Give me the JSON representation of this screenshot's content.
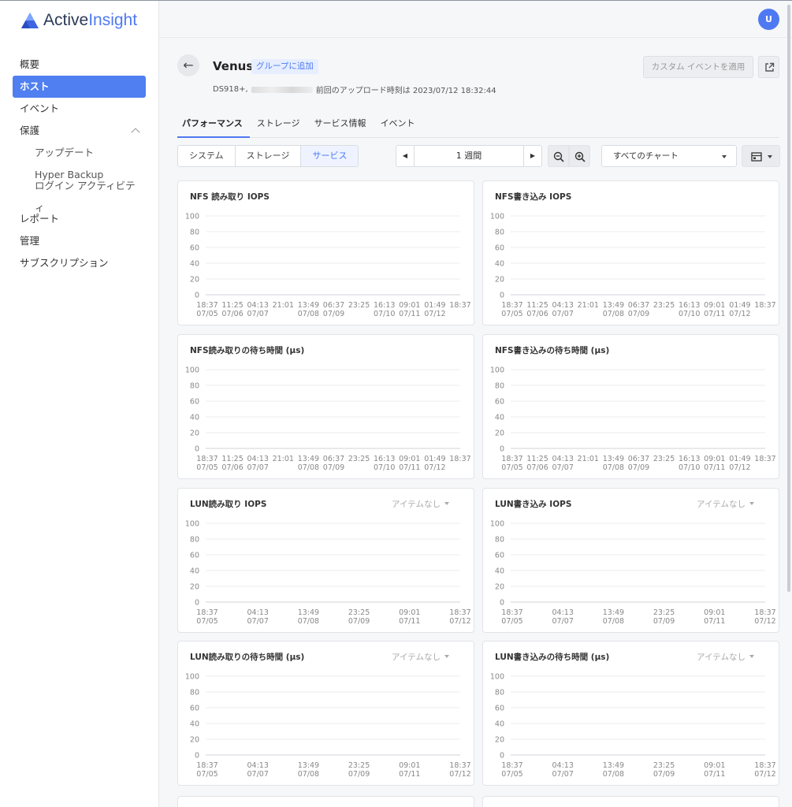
{
  "app": {
    "logo_prefix": "Active",
    "logo_accent": "Insight",
    "user_initial": "U"
  },
  "sidebar": {
    "items": [
      {
        "label": "概要",
        "active": false,
        "sub": false
      },
      {
        "label": "ホスト",
        "active": true,
        "sub": false
      },
      {
        "label": "イベント",
        "active": false,
        "sub": false
      },
      {
        "label": "保護",
        "active": false,
        "sub": false,
        "expanded": true
      },
      {
        "label": "アップデート",
        "active": false,
        "sub": true
      },
      {
        "label": "Hyper Backup",
        "active": false,
        "sub": true
      },
      {
        "label": "ログイン アクティビティ",
        "active": false,
        "sub": true
      },
      {
        "label": "レポート",
        "active": false,
        "sub": false
      },
      {
        "label": "管理",
        "active": false,
        "sub": false
      },
      {
        "label": "サブスクリプション",
        "active": false,
        "sub": false
      }
    ]
  },
  "header": {
    "host_name": "Venus",
    "group_badge": "グループに追加",
    "model": "DS918+,",
    "last_upload_text": "前回のアップロード時刻は 2023/07/12 18:32:44",
    "custom_event_button": "カスタム イベントを適用"
  },
  "tabs": [
    "パフォーマンス",
    "ストレージ",
    "サービス情報",
    "イベント"
  ],
  "toolbar": {
    "segments": [
      {
        "label": "システム",
        "active": false
      },
      {
        "label": "ストレージ",
        "active": false
      },
      {
        "label": "サービス",
        "active": true
      }
    ],
    "range_label": "1 週間",
    "chart_filter": "すべてのチャート"
  },
  "colors": {
    "accent": "#4f79f2",
    "active_nav": "#4f7ff0"
  },
  "chart_data": [
    {
      "type": "line",
      "title": "NFS 読み取り IOPS",
      "empty_selector": "",
      "yticks": [
        "100",
        "80",
        "60",
        "40",
        "20",
        "0"
      ],
      "ylim": [
        0,
        100
      ],
      "series": [],
      "xticks": [
        [
          "18:37",
          "07/05"
        ],
        [
          "11:25",
          "07/06"
        ],
        [
          "04:13",
          "07/07"
        ],
        [
          "21:01",
          ""
        ],
        [
          "13:49",
          "07/08"
        ],
        [
          "06:37",
          "07/09"
        ],
        [
          "23:25",
          ""
        ],
        [
          "16:13",
          "07/10"
        ],
        [
          "09:01",
          "07/11"
        ],
        [
          "01:49",
          "07/12"
        ],
        [
          "18:37",
          ""
        ]
      ]
    },
    {
      "type": "line",
      "title": "NFS書き込み IOPS",
      "empty_selector": "",
      "yticks": [
        "100",
        "80",
        "60",
        "40",
        "20",
        "0"
      ],
      "ylim": [
        0,
        100
      ],
      "series": [],
      "xticks": [
        [
          "18:37",
          "07/05"
        ],
        [
          "11:25",
          "07/06"
        ],
        [
          "04:13",
          "07/07"
        ],
        [
          "21:01",
          ""
        ],
        [
          "13:49",
          "07/08"
        ],
        [
          "06:37",
          "07/09"
        ],
        [
          "23:25",
          ""
        ],
        [
          "16:13",
          "07/10"
        ],
        [
          "09:01",
          "07/11"
        ],
        [
          "01:49",
          "07/12"
        ],
        [
          "18:37",
          ""
        ]
      ]
    },
    {
      "type": "line",
      "title": "NFS読み取りの待ち時間 (µs)",
      "empty_selector": "",
      "yticks": [
        "100",
        "80",
        "60",
        "40",
        "20",
        "0"
      ],
      "ylim": [
        0,
        100
      ],
      "series": [],
      "xticks": [
        [
          "18:37",
          "07/05"
        ],
        [
          "11:25",
          "07/06"
        ],
        [
          "04:13",
          "07/07"
        ],
        [
          "21:01",
          ""
        ],
        [
          "13:49",
          "07/08"
        ],
        [
          "06:37",
          "07/09"
        ],
        [
          "23:25",
          ""
        ],
        [
          "16:13",
          "07/10"
        ],
        [
          "09:01",
          "07/11"
        ],
        [
          "01:49",
          "07/12"
        ],
        [
          "18:37",
          ""
        ]
      ]
    },
    {
      "type": "line",
      "title": "NFS書き込みの待ち時間 (µs)",
      "empty_selector": "",
      "yticks": [
        "100",
        "80",
        "60",
        "40",
        "20",
        "0"
      ],
      "ylim": [
        0,
        100
      ],
      "series": [],
      "xticks": [
        [
          "18:37",
          "07/05"
        ],
        [
          "11:25",
          "07/06"
        ],
        [
          "04:13",
          "07/07"
        ],
        [
          "21:01",
          ""
        ],
        [
          "13:49",
          "07/08"
        ],
        [
          "06:37",
          "07/09"
        ],
        [
          "23:25",
          ""
        ],
        [
          "16:13",
          "07/10"
        ],
        [
          "09:01",
          "07/11"
        ],
        [
          "01:49",
          "07/12"
        ],
        [
          "18:37",
          ""
        ]
      ]
    },
    {
      "type": "line",
      "title": "LUN読み取り IOPS",
      "empty_selector": "アイテムなし",
      "yticks": [
        "100",
        "80",
        "60",
        "40",
        "20",
        "0"
      ],
      "ylim": [
        0,
        100
      ],
      "series": [],
      "xticks": [
        [
          "18:37",
          "07/05"
        ],
        [
          "04:13",
          "07/07"
        ],
        [
          "13:49",
          "07/08"
        ],
        [
          "23:25",
          "07/09"
        ],
        [
          "09:01",
          "07/11"
        ],
        [
          "18:37",
          "07/12"
        ]
      ]
    },
    {
      "type": "line",
      "title": "LUN書き込み IOPS",
      "empty_selector": "アイテムなし",
      "yticks": [
        "100",
        "80",
        "60",
        "40",
        "20",
        "0"
      ],
      "ylim": [
        0,
        100
      ],
      "series": [],
      "xticks": [
        [
          "18:37",
          "07/05"
        ],
        [
          "04:13",
          "07/07"
        ],
        [
          "13:49",
          "07/08"
        ],
        [
          "23:25",
          "07/09"
        ],
        [
          "09:01",
          "07/11"
        ],
        [
          "18:37",
          "07/12"
        ]
      ]
    },
    {
      "type": "line",
      "title": "LUN読み取りの待ち時間 (µs)",
      "empty_selector": "アイテムなし",
      "yticks": [
        "100",
        "80",
        "60",
        "40",
        "20",
        "0"
      ],
      "ylim": [
        0,
        100
      ],
      "series": [],
      "xticks": [
        [
          "18:37",
          "07/05"
        ],
        [
          "04:13",
          "07/07"
        ],
        [
          "13:49",
          "07/08"
        ],
        [
          "23:25",
          "07/09"
        ],
        [
          "09:01",
          "07/11"
        ],
        [
          "18:37",
          "07/12"
        ]
      ]
    },
    {
      "type": "line",
      "title": "LUN書き込みの待ち時間 (µs)",
      "empty_selector": "アイテムなし",
      "yticks": [
        "100",
        "80",
        "60",
        "40",
        "20",
        "0"
      ],
      "ylim": [
        0,
        100
      ],
      "series": [],
      "xticks": [
        [
          "18:37",
          "07/05"
        ],
        [
          "04:13",
          "07/07"
        ],
        [
          "13:49",
          "07/08"
        ],
        [
          "23:25",
          "07/09"
        ],
        [
          "09:01",
          "07/11"
        ],
        [
          "18:37",
          "07/12"
        ]
      ]
    }
  ]
}
